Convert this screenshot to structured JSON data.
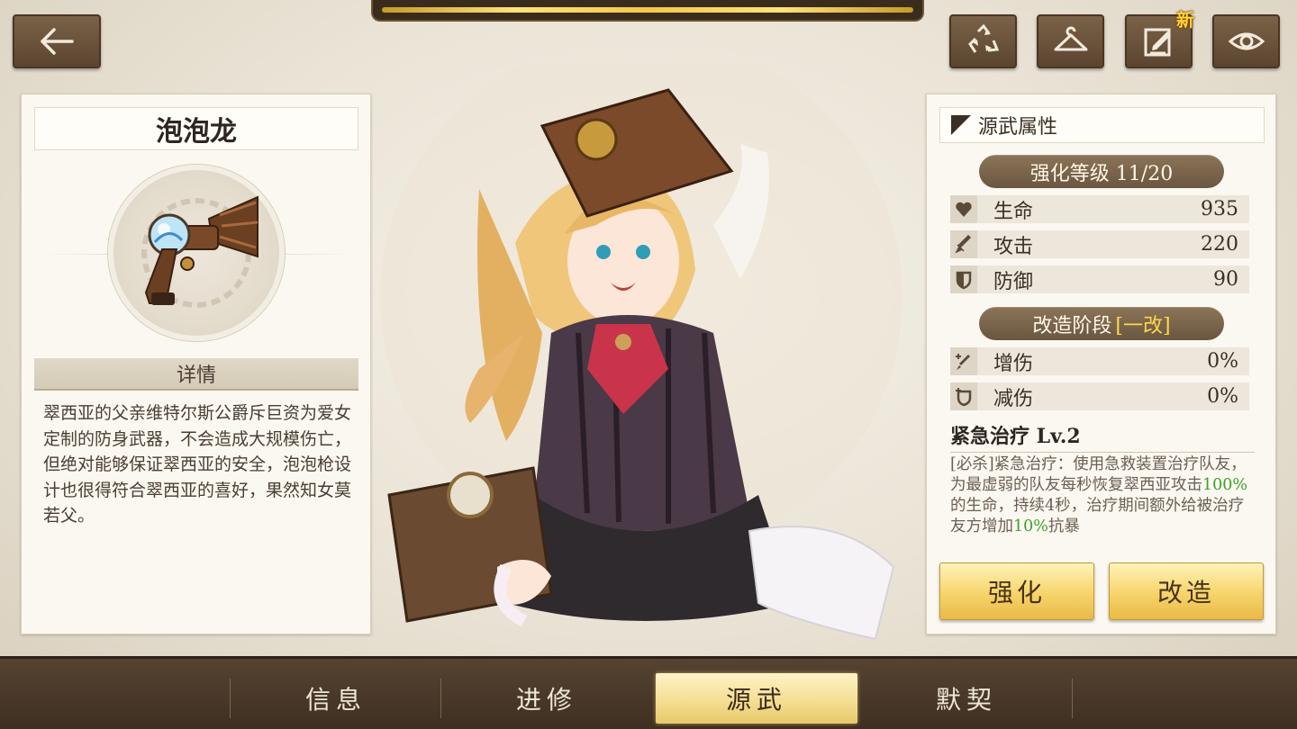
{
  "top": {
    "back_icon": "arrow-left-icon",
    "buttons": [
      {
        "icon": "recycle-icon"
      },
      {
        "icon": "hanger-icon"
      },
      {
        "icon": "edit-note-icon",
        "badge": "新"
      },
      {
        "icon": "eye-icon"
      }
    ]
  },
  "weapon": {
    "name": "泡泡龙",
    "detail_title": "详情",
    "description": "翠西亚的父亲维特尔斯公爵斥巨资为爱女定制的防身武器，不会造成大规模伤亡，但绝对能够保证翠西亚的安全，泡泡枪设计也很得符合翠西亚的喜好，果然知女莫若父。"
  },
  "attributes": {
    "title": "源武属性",
    "enhance_label": "强化等级 11/20",
    "stats": [
      {
        "icon": "heart-icon",
        "label": "生命",
        "value": "935"
      },
      {
        "icon": "sword-icon",
        "label": "攻击",
        "value": "220"
      },
      {
        "icon": "shield-icon",
        "label": "防御",
        "value": "90"
      }
    ],
    "refine_label": "改造阶段",
    "refine_stage": "[一改]",
    "refine_stats": [
      {
        "icon": "sword-plus-icon",
        "label": "增伤",
        "value": "0%"
      },
      {
        "icon": "shield-plus-icon",
        "label": "减伤",
        "value": "0%"
      }
    ],
    "skill": {
      "name": "紧急治疗 Lv.2",
      "desc_1": "[必杀]紧急治疗：使用急救装置治疗队友，为最虚弱的队友每秒恢复翠西亚攻击",
      "desc_pct1": "100%",
      "desc_2": "的生命，持续4秒，治疗期间额外给被治疗友方增加",
      "desc_pct2": "10%",
      "desc_3": "抗暴"
    },
    "enhance_button": "强化",
    "refine_button": "改造"
  },
  "tabs": [
    {
      "label": "信息"
    },
    {
      "label": "进修"
    },
    {
      "label": "源武",
      "active": true
    },
    {
      "label": "默契"
    }
  ],
  "colors": {
    "accent_gold": "#f5c84a",
    "highlight_green": "#3ea02a",
    "stage_yellow": "#ffd84a",
    "panel_brown": "#6a5640"
  }
}
